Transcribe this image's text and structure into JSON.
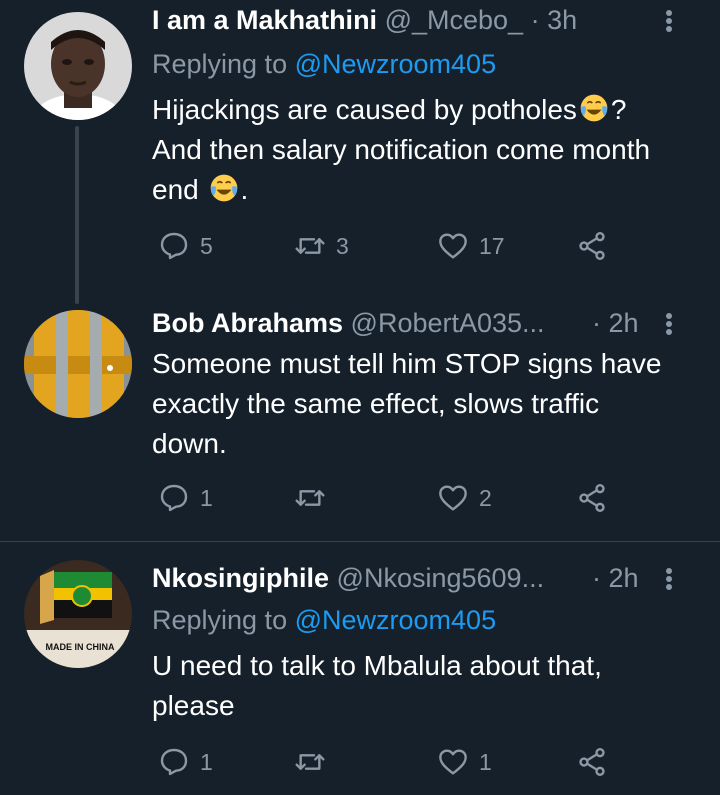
{
  "tweets": [
    {
      "name": "I am a Makhathini",
      "handle": "@_Mcebo_",
      "dot": "·",
      "time": "3h",
      "reply_prefix": "Replying to",
      "reply_mention": "@Newzroom405",
      "text_line1": "Hijackings are caused by potholes",
      "text_line1_after": "?",
      "text_line2": "And then salary notification come month",
      "text_line3": "end",
      "text_line3_after": ".",
      "emoji": "face-with-tears-of-joy",
      "replies": "5",
      "retweets": "3",
      "likes": "17"
    },
    {
      "name": "Bob Abrahams",
      "handle": "@RobertA035...",
      "dot": "·",
      "time": "2h",
      "text_line1": "Someone must tell him STOP signs have",
      "text_line2": "exactly the same effect, slows traffic",
      "text_line3": "down.",
      "replies": "1",
      "retweets": "",
      "likes": "2"
    },
    {
      "name": "Nkosingiphile",
      "handle": "@Nkosing5609...",
      "dot": "·",
      "time": "2h",
      "reply_prefix": "Replying to",
      "reply_mention": "@Newzroom405",
      "text_line1": "U need to talk to Mbalula about that,",
      "text_line2": "please",
      "avatar_caption": "MADE IN CHINA",
      "replies": "1",
      "retweets": "",
      "likes": "1"
    }
  ],
  "colors": {
    "background": "#15202b",
    "secondary_text": "#8b98a5",
    "link": "#1d9bf0",
    "divider": "#38444d"
  }
}
